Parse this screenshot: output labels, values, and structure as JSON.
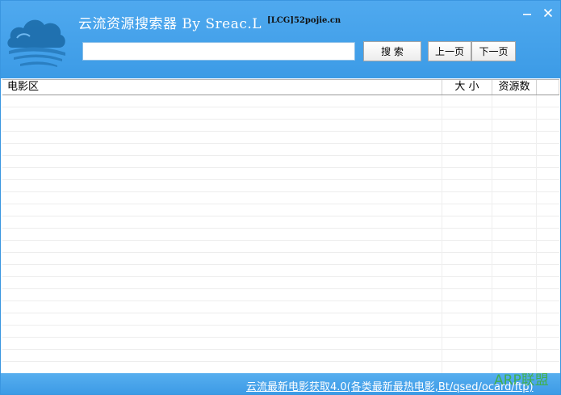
{
  "window": {
    "title": "云流资源搜索器  By Sreac.L",
    "title_suffix": "[LCG]52pojie.cn",
    "minimize_icon": "minimize-icon",
    "close_icon": "close-icon"
  },
  "search": {
    "value": "",
    "placeholder": "",
    "search_label": "搜 索",
    "prev_label": "上一页",
    "next_label": "下一页"
  },
  "table": {
    "columns": [
      "电影区",
      "大 小",
      "资源数",
      ""
    ],
    "rows": []
  },
  "status": {
    "link_text": "云流最新电影获取4.0(各类最新最热电影,Bt/qsed/ocard/ftp)"
  },
  "watermark": {
    "text": "ARP联盟"
  },
  "colors": {
    "accent": "#3c9be6",
    "header_light": "#4fa9ef"
  }
}
